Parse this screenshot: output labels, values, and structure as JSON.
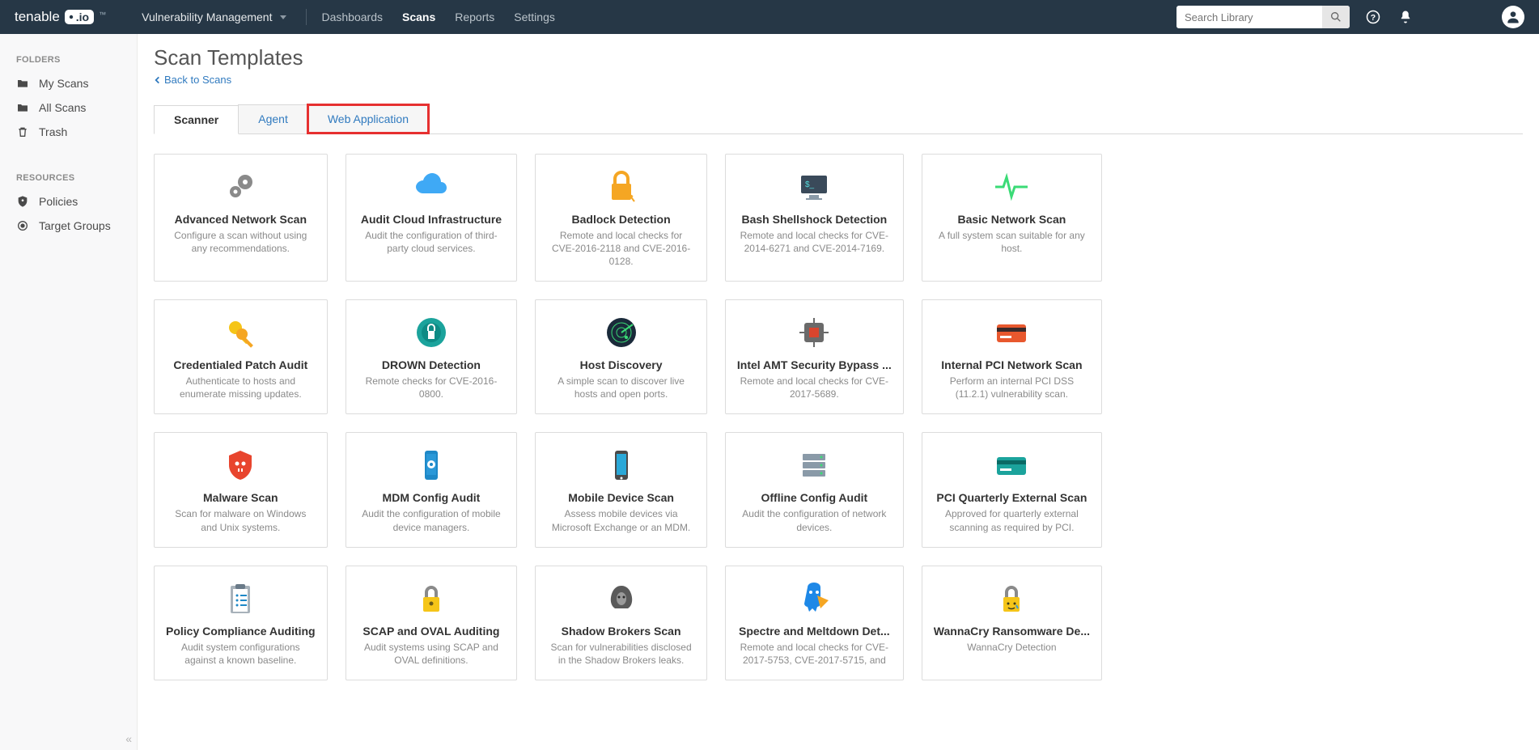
{
  "brand": {
    "name": "tenable",
    "suffix": ".io",
    "tm": "™"
  },
  "nav_app": {
    "label": "Vulnerability Management"
  },
  "nav_main": [
    {
      "label": "Dashboards",
      "active": false
    },
    {
      "label": "Scans",
      "active": true
    },
    {
      "label": "Reports",
      "active": false
    },
    {
      "label": "Settings",
      "active": false
    }
  ],
  "search": {
    "placeholder": "Search Library"
  },
  "sidebar": {
    "section1": "FOLDERS",
    "items1": [
      {
        "label": "My Scans",
        "icon": "folder"
      },
      {
        "label": "All Scans",
        "icon": "folder"
      },
      {
        "label": "Trash",
        "icon": "trash"
      }
    ],
    "section2": "RESOURCES",
    "items2": [
      {
        "label": "Policies",
        "icon": "shield"
      },
      {
        "label": "Target Groups",
        "icon": "target"
      }
    ],
    "collapse": "«"
  },
  "page": {
    "title": "Scan Templates",
    "back": "Back to Scans"
  },
  "tabs": [
    {
      "label": "Scanner",
      "active": true,
      "highlight": false
    },
    {
      "label": "Agent",
      "active": false,
      "highlight": false
    },
    {
      "label": "Web Application",
      "active": false,
      "highlight": true
    }
  ],
  "templates": [
    {
      "title": "Advanced Network Scan",
      "desc": "Configure a scan without using any recommendations.",
      "icon": "gears"
    },
    {
      "title": "Audit Cloud Infrastructure",
      "desc": "Audit the configuration of third-party cloud services.",
      "icon": "cloud"
    },
    {
      "title": "Badlock Detection",
      "desc": "Remote and local checks for CVE-2016-2118 and CVE-2016-0128.",
      "icon": "badlock"
    },
    {
      "title": "Bash Shellshock Detection",
      "desc": "Remote and local checks for CVE-2014-6271 and CVE-2014-7169.",
      "icon": "terminal"
    },
    {
      "title": "Basic Network Scan",
      "desc": "A full system scan suitable for any host.",
      "icon": "pulse"
    },
    {
      "title": "Credentialed Patch Audit",
      "desc": "Authenticate to hosts and enumerate missing updates.",
      "icon": "keys"
    },
    {
      "title": "DROWN Detection",
      "desc": "Remote checks for CVE-2016-0800.",
      "icon": "drown"
    },
    {
      "title": "Host Discovery",
      "desc": "A simple scan to discover live hosts and open ports.",
      "icon": "radar"
    },
    {
      "title": "Intel AMT Security Bypass ...",
      "desc": "Remote and local checks for CVE-2017-5689.",
      "icon": "cpu"
    },
    {
      "title": "Internal PCI Network Scan",
      "desc": "Perform an internal PCI DSS (11.2.1) vulnerability scan.",
      "icon": "card-orange"
    },
    {
      "title": "Malware Scan",
      "desc": "Scan for malware on Windows and Unix systems.",
      "icon": "skull"
    },
    {
      "title": "MDM Config Audit",
      "desc": "Audit the configuration of mobile device managers.",
      "icon": "phone-gear"
    },
    {
      "title": "Mobile Device Scan",
      "desc": "Assess mobile devices via Microsoft Exchange or an MDM.",
      "icon": "phone"
    },
    {
      "title": "Offline Config Audit",
      "desc": "Audit the configuration of network devices.",
      "icon": "servers"
    },
    {
      "title": "PCI Quarterly External Scan",
      "desc": "Approved for quarterly external scanning as required by PCI.",
      "icon": "card-teal"
    },
    {
      "title": "Policy Compliance Auditing",
      "desc": "Audit system configurations against a known baseline.",
      "icon": "clipboard"
    },
    {
      "title": "SCAP and OVAL Auditing",
      "desc": "Audit systems using SCAP and OVAL definitions.",
      "icon": "lock-yellow"
    },
    {
      "title": "Shadow Brokers Scan",
      "desc": "Scan for vulnerabilities disclosed in the Shadow Brokers leaks.",
      "icon": "shadow"
    },
    {
      "title": "Spectre and Meltdown Det...",
      "desc": "Remote and local checks for CVE-2017-5753, CVE-2017-5715, and",
      "icon": "spectre"
    },
    {
      "title": "WannaCry Ransomware De...",
      "desc": "WannaCry Detection",
      "icon": "lock-cry"
    }
  ]
}
